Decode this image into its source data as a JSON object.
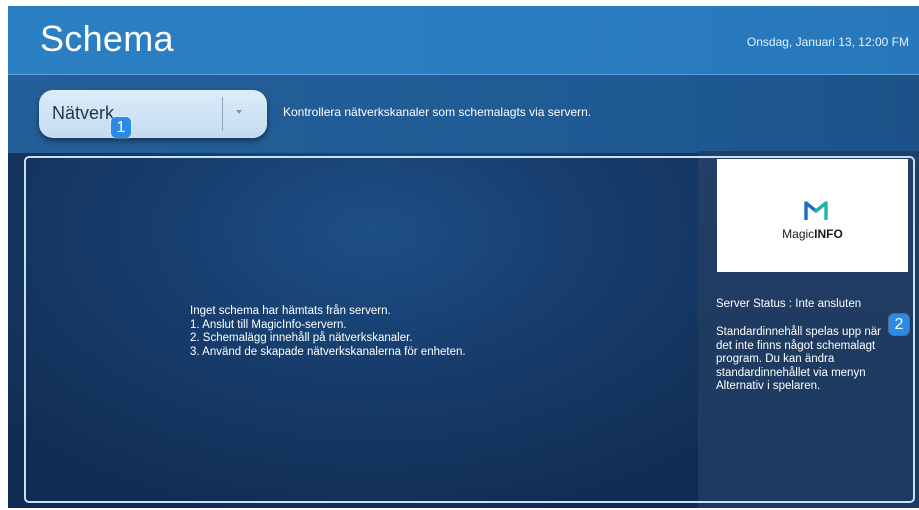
{
  "header": {
    "title": "Schema",
    "datetime": "Onsdag, Januari 13, 12:00 FM"
  },
  "toolbar": {
    "dropdown_value": "Nätverk",
    "dropdown_icon": "chevron-down-icon",
    "description": "Kontrollera nätverkskanaler som schemalagts via servern."
  },
  "callouts": [
    "1",
    "2"
  ],
  "main": {
    "message_lines": [
      "Inget schema har hämtats från servern.",
      "1. Anslut till MagicInfo-servern.",
      "2. Schemalägg innehåll på nätverkskanaler.",
      "3. Använd de skapade nätverkskanalerna för enheten."
    ]
  },
  "side": {
    "logo_text_prefix": "Magic",
    "logo_text_bold": "INFO",
    "server_status": "Server Status : Inte ansluten",
    "description": "Standardinnehåll spelas upp när det inte finns något schemalagt program. Du kan ändra standardinnehållet via menyn Alternativ i spelaren."
  },
  "colors": {
    "header_bg": "#2b7fc3",
    "toolbar_bg": "#245f99",
    "content_bg": "#173d6d",
    "callout_bg": "#2a8ae6",
    "logo_accent": "#1a6fbf",
    "logo_secondary": "#21b3a5"
  }
}
